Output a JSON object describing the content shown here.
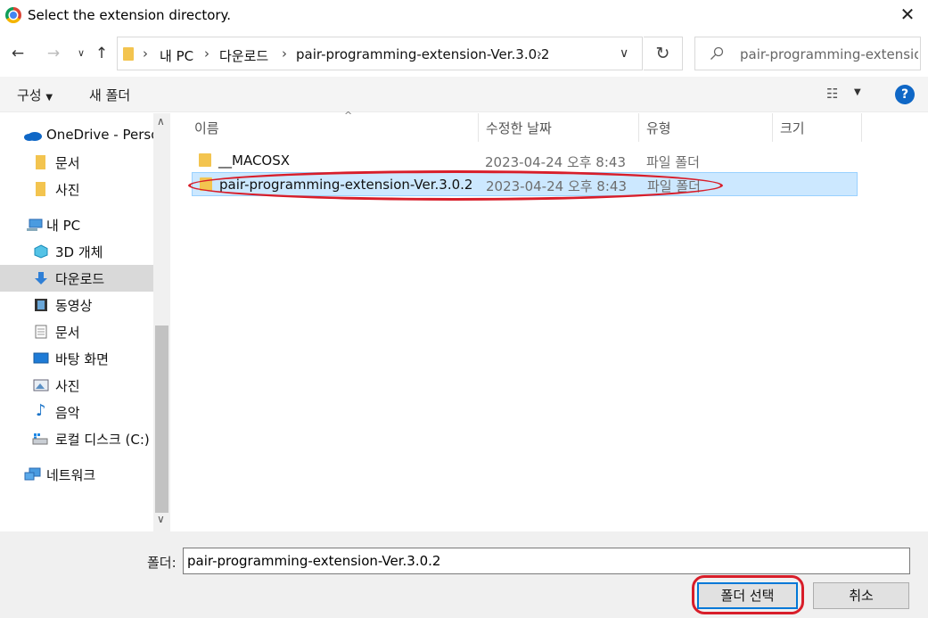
{
  "window": {
    "title": "Select the extension directory."
  },
  "breadcrumbs": [
    "내 PC",
    "다운로드",
    "pair-programming-extension-Ver.3.0.2"
  ],
  "search": {
    "placeholder": "pair-programming-extensio..."
  },
  "commands": {
    "organize": "구성",
    "new_folder": "새 폴더"
  },
  "sidebar": {
    "items": [
      {
        "label": "OneDrive - Person",
        "icon": "onedrive-icon"
      },
      {
        "label": "문서",
        "icon": "folder-icon"
      },
      {
        "label": "사진",
        "icon": "folder-icon"
      },
      {
        "label": "내 PC",
        "icon": "pc-icon"
      },
      {
        "label": "3D 개체",
        "icon": "cube-icon"
      },
      {
        "label": "다운로드",
        "icon": "download-icon",
        "selected": true
      },
      {
        "label": "동영상",
        "icon": "video-icon"
      },
      {
        "label": "문서",
        "icon": "document-icon"
      },
      {
        "label": "바탕 화면",
        "icon": "desktop-icon"
      },
      {
        "label": "사진",
        "icon": "picture-icon"
      },
      {
        "label": "음악",
        "icon": "music-icon"
      },
      {
        "label": "로컬 디스크 (C:)",
        "icon": "drive-icon"
      },
      {
        "label": "네트워크",
        "icon": "network-icon"
      }
    ]
  },
  "columns": {
    "name": "이름",
    "modified": "수정한 날짜",
    "type": "유형",
    "size": "크기"
  },
  "files": [
    {
      "name": "__MACOSX",
      "modified": "2023-04-24 오후 8:43",
      "type": "파일 폴더"
    },
    {
      "name": "pair-programming-extension-Ver.3.0.2",
      "modified": "2023-04-24 오후 8:43",
      "type": "파일 폴더",
      "selected": true
    }
  ],
  "footer": {
    "folder_label": "폴더:",
    "folder_value": "pair-programming-extension-Ver.3.0.2",
    "select_button": "폴더 선택",
    "cancel_button": "취소"
  },
  "colors": {
    "selection": "#cce8ff",
    "highlight": "#d81e2a",
    "accent": "#0078d7"
  }
}
